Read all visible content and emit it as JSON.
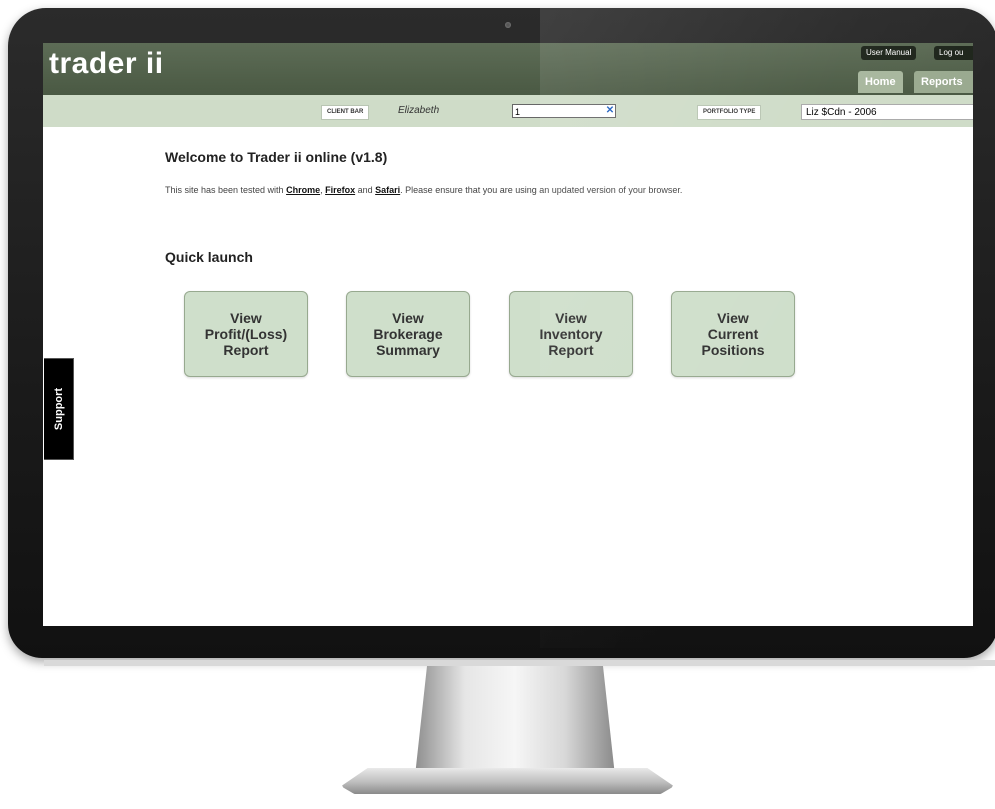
{
  "header": {
    "logo": "trader ii",
    "top_links": [
      "User Manual",
      "Log ou"
    ],
    "tabs": [
      "Home",
      "Reports"
    ]
  },
  "client_bar": {
    "client_label": "CLIENT BAR",
    "client_name": "Elizabeth",
    "input_value": "1",
    "portfolio_label": "PORTFOLIO TYPE",
    "portfolio_value": "Liz $Cdn - 2006"
  },
  "main": {
    "welcome": "Welcome to Trader ii online (v1.8)",
    "tested_prefix": "This site has been tested with ",
    "browsers": [
      "Chrome",
      "Firefox",
      "Safari"
    ],
    "tested_and": " and ",
    "tested_suffix": ". Please ensure that you are using an updated version of your browser.",
    "quick_launch": "Quick launch",
    "tiles": [
      [
        "View",
        "Profit/(Loss)",
        "Report"
      ],
      [
        "View",
        "Brokerage",
        "Summary"
      ],
      [
        "View",
        "Inventory",
        "Report"
      ],
      [
        "View",
        "Current",
        "Positions"
      ]
    ]
  },
  "support": "Support",
  "colors": {
    "header": "#4f5e48",
    "client_bar": "#cfdcc8",
    "tile": "#cfdfcb"
  }
}
